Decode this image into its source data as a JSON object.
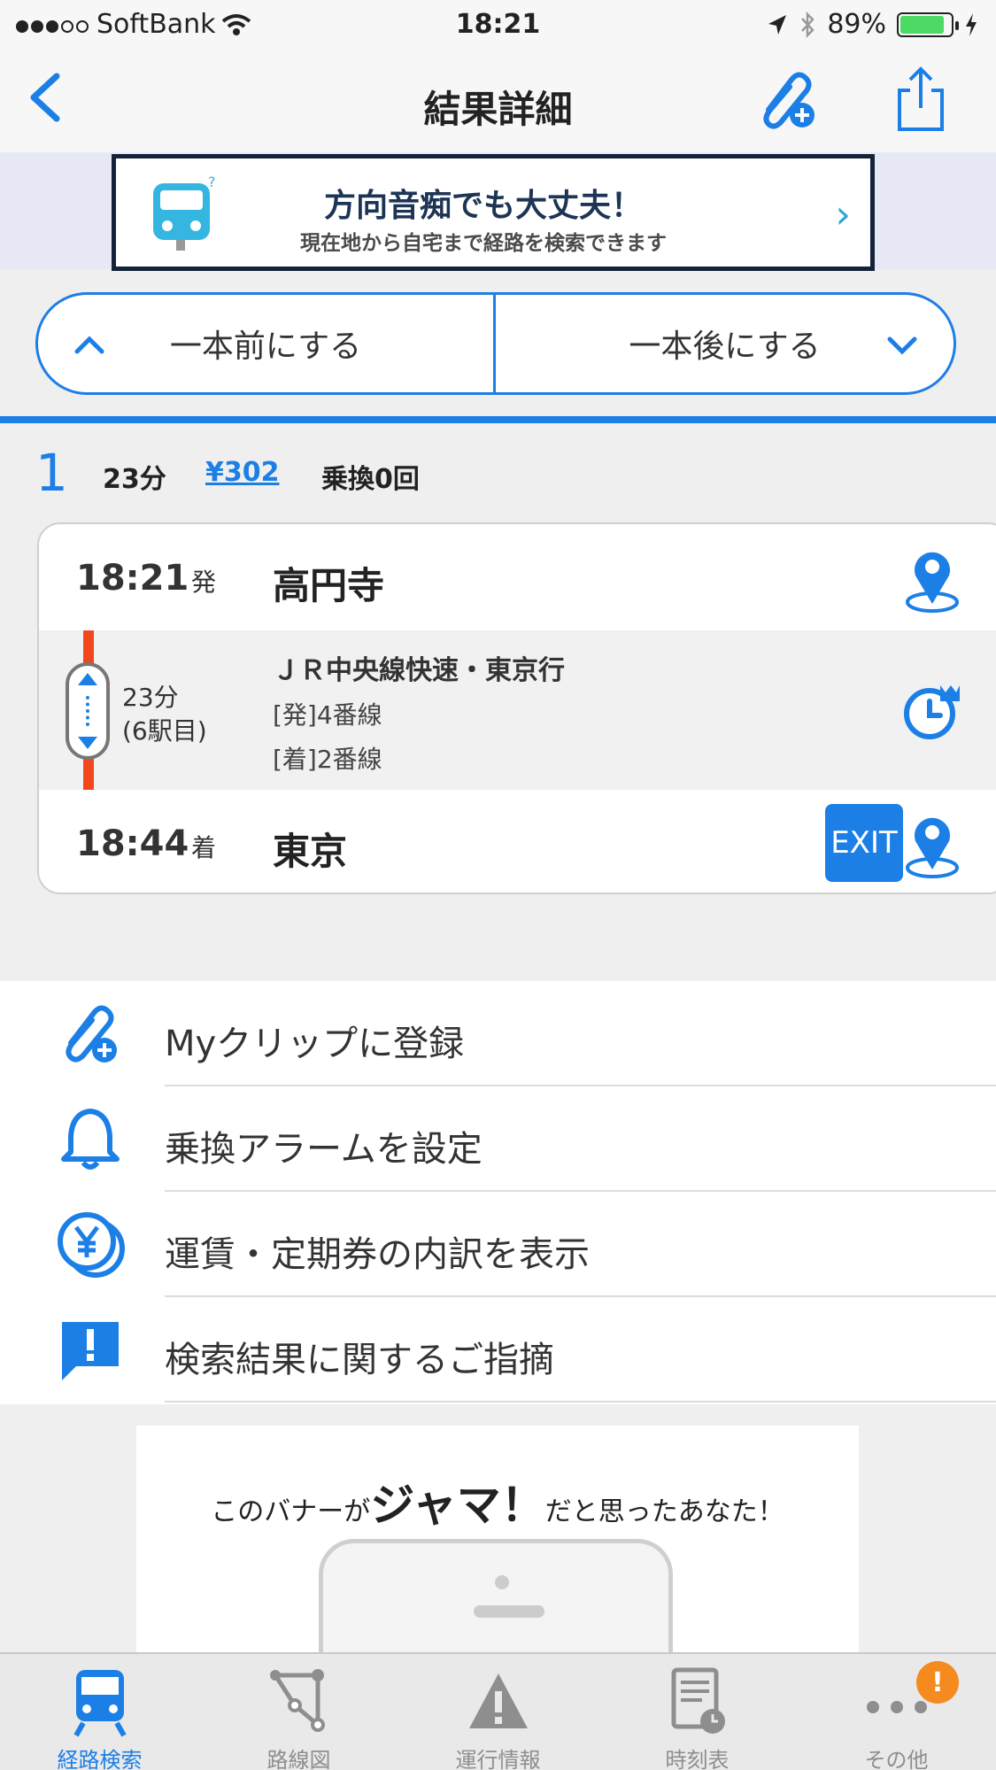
{
  "status_bar": {
    "carrier": "SoftBank",
    "time": "18:21",
    "battery": "89%"
  },
  "nav": {
    "title": "結果詳細"
  },
  "ad_banner": {
    "headline": "方向音痴でも大丈夫！",
    "subline": "現在地から自宅まで経路を検索できます"
  },
  "segment": {
    "prev_label": "一本前にする",
    "next_label": "一本後にする"
  },
  "route": {
    "index": "1",
    "duration": "23分",
    "fare": "¥302",
    "transfers": "乗換0回",
    "departure": {
      "time": "18:21",
      "mark": "発",
      "station": "高円寺"
    },
    "ride": {
      "duration": "23分",
      "stops": "(6駅目)",
      "line": "ＪＲ中央線快速・東京行",
      "dep_platform": "[発]4番線",
      "arr_platform": "[着]2番線",
      "line_color": "#f2461c"
    },
    "arrival": {
      "time": "18:44",
      "mark": "着",
      "station": "東京",
      "exit_label": "EXIT"
    }
  },
  "actions": [
    {
      "label": "Myクリップに登録",
      "icon": "clip-add-icon"
    },
    {
      "label": "乗換アラームを設定",
      "icon": "bell-icon"
    },
    {
      "label": "運賃・定期券の内訳を表示",
      "icon": "yen-icon"
    },
    {
      "label": "検索結果に関するご指摘",
      "icon": "feedback-icon"
    }
  ],
  "ad2": {
    "text_before": "このバナーが",
    "text_big": "ジャマ！",
    "text_after": "だと思ったあなた！"
  },
  "tabs": [
    {
      "label": "経路検索",
      "icon": "train-icon",
      "active": true
    },
    {
      "label": "路線図",
      "icon": "route-map-icon",
      "active": false
    },
    {
      "label": "運行情報",
      "icon": "warning-icon",
      "active": false
    },
    {
      "label": "時刻表",
      "icon": "timetable-icon",
      "active": false
    },
    {
      "label": "その他",
      "icon": "more-icon",
      "active": false,
      "badge": "!"
    }
  ],
  "colors": {
    "accent": "#1c7fe6",
    "badge": "#f58a1f",
    "ad_border": "#13233a"
  }
}
